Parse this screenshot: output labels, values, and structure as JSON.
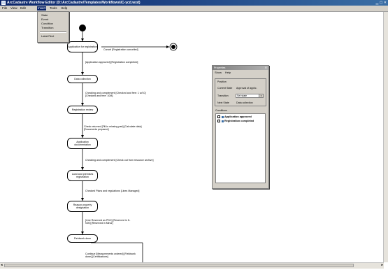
{
  "window": {
    "title": "ArcCadastre Workflow Editor (D:\\ArcCadastre\\Templates\\Workflows\\IC-ycd.wxd)",
    "controls": "▁ ▢ ✕"
  },
  "menu": {
    "items": [
      "File",
      "View",
      "Edit",
      "Insert",
      "Tools",
      "Help"
    ],
    "active_index": 3
  },
  "insert_menu": {
    "items": [
      "State",
      "Event",
      "Condition",
      "Transition",
      "Label/Text"
    ]
  },
  "diagram": {
    "states": [
      "Application for registration",
      "Data collection",
      "Registration review",
      "Application documentation",
      "Land and premises registration",
      "Reason property designation",
      "Fieldwork done"
    ],
    "transitions": [
      "Cancel [Registration cancelled]",
      "[Application approved] [Registration completed]",
      "Checking and complement [Checked and free: 1 w/10] [Checked and free: 10/8]",
      "Check returned [Fill-in missing part] [Calculate data] [Documents prepared]",
      "Checking and complement [Check out from resource archive]",
      "Checked Plans and regulations [Lines Managed]",
      "[Line Reserved as PDC] [Reserved in K-N00] [Reserved in Minor]",
      "Continue [Measurements ordered] [Fieldwork done] [Certifications]"
    ]
  },
  "properties_panel": {
    "title": "Properties",
    "menu": [
      "Show",
      "Help"
    ],
    "position_group": "Position",
    "current_state_label": "Current State",
    "current_state_value": "Approval of applic.",
    "transition_label": "Transition",
    "transition_value": "Set state",
    "next_state_label": "Next State",
    "next_state_value": "Data collection",
    "conditions_label": "Conditions",
    "conditions": [
      "Application approved",
      "Registration completed"
    ]
  },
  "scrollbar": {
    "left_arrow": "◂",
    "right_arrow": "▸"
  }
}
